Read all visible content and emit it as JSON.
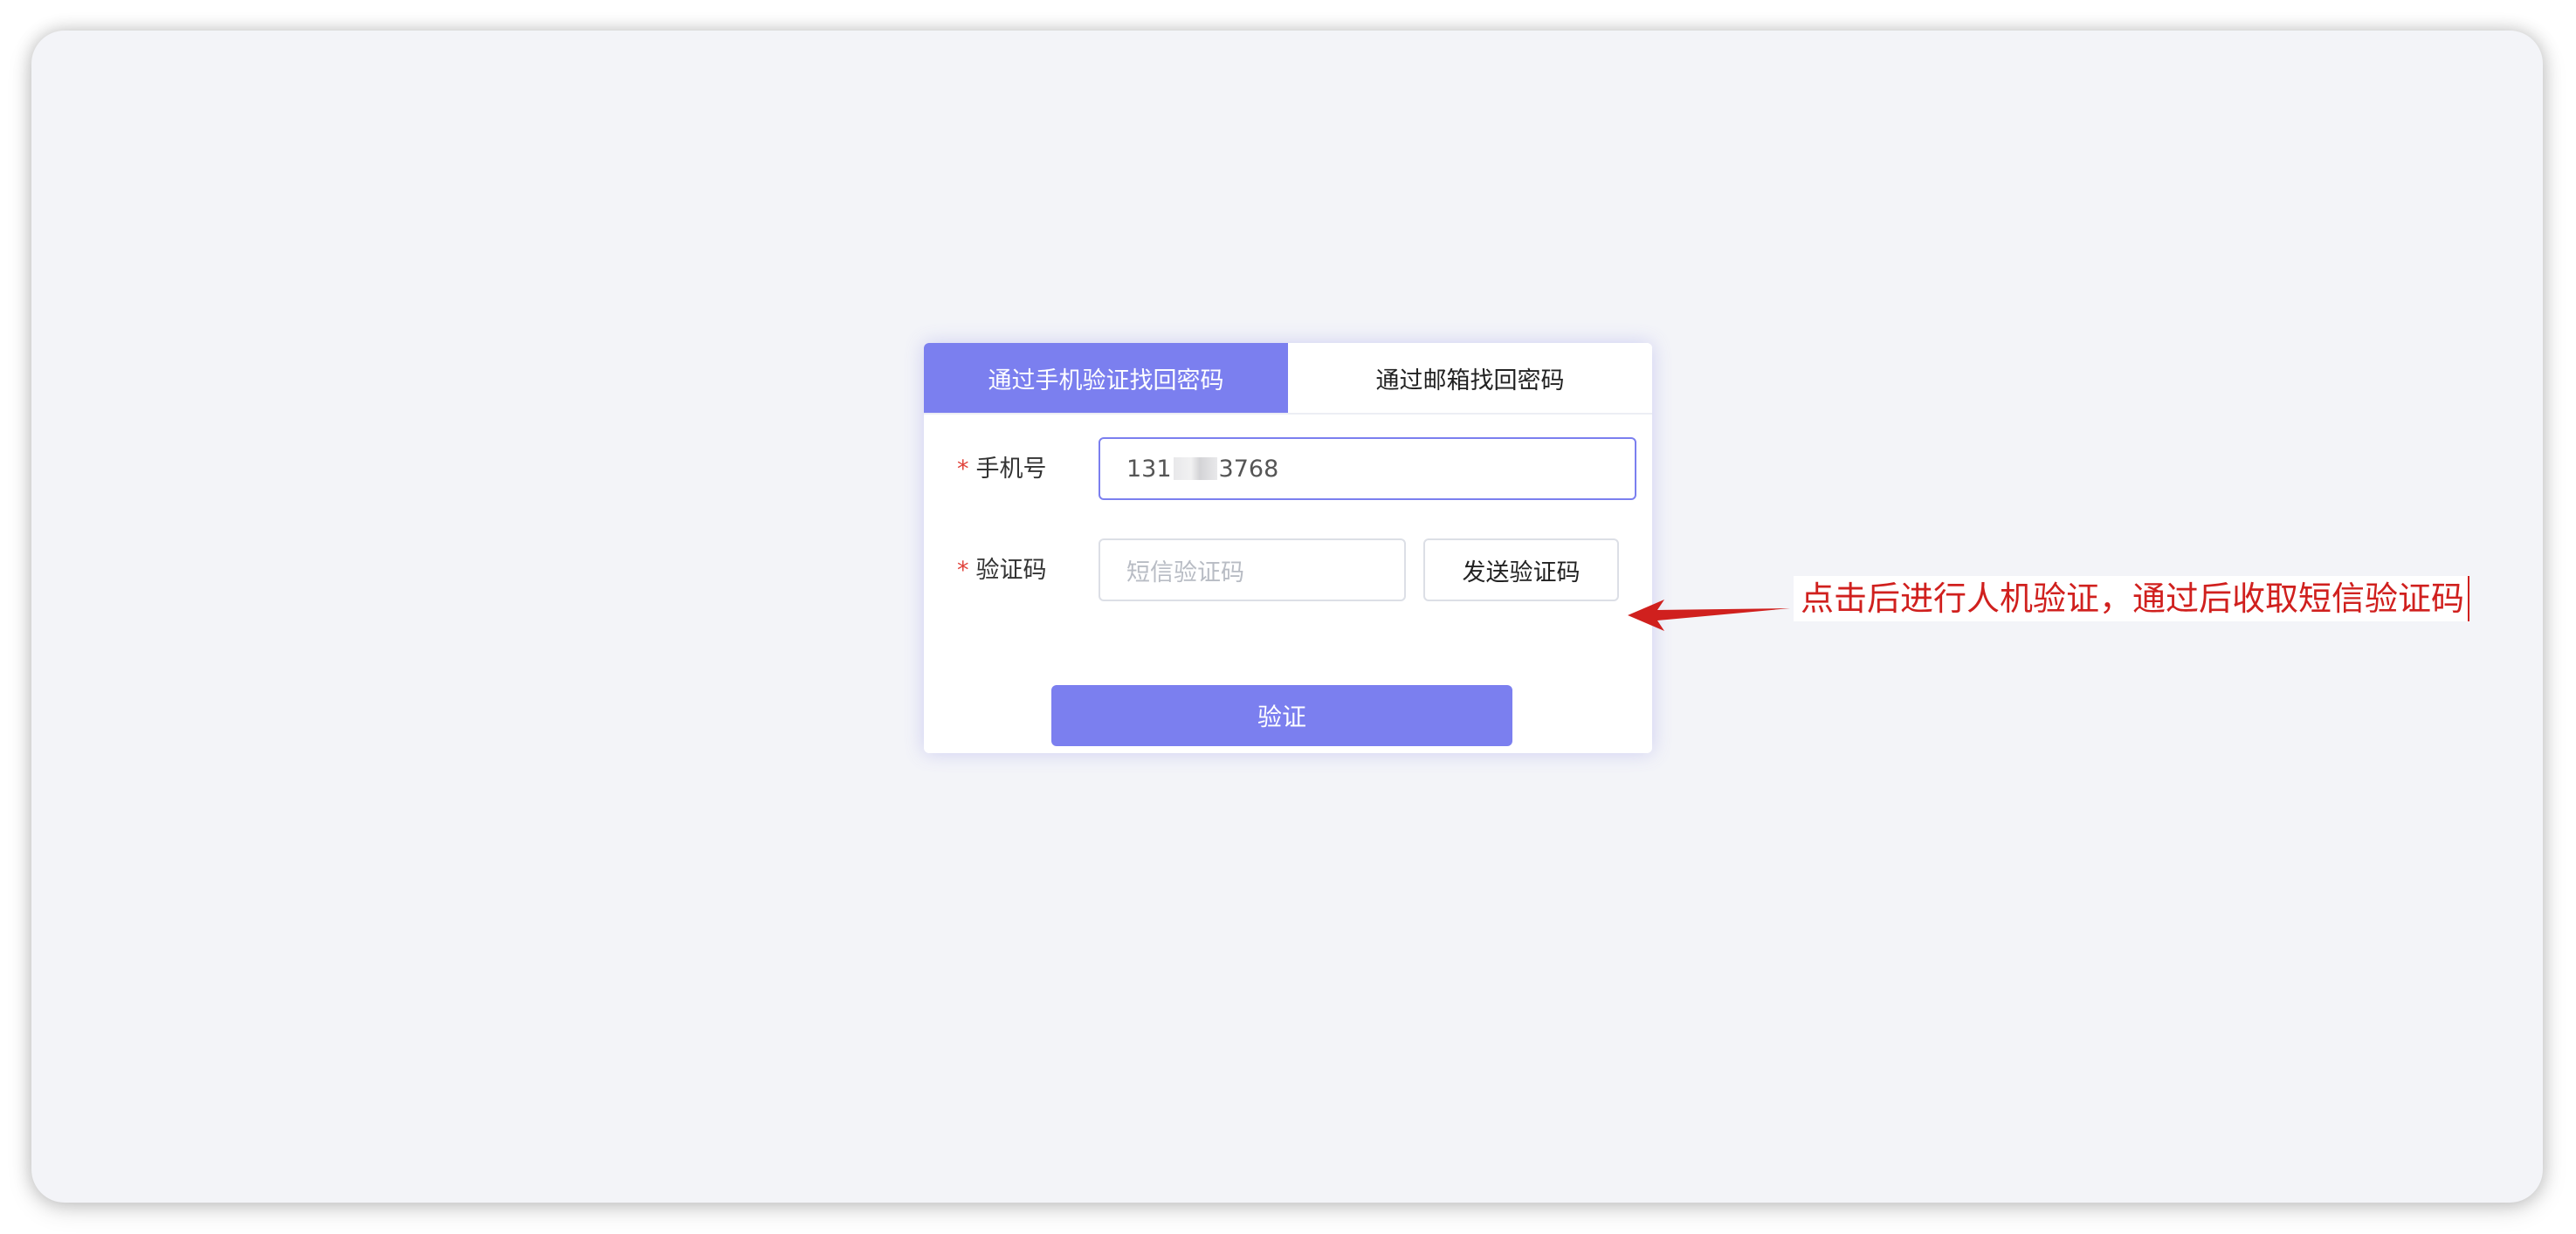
{
  "tabs": [
    {
      "label": "通过手机验证找回密码",
      "active": true
    },
    {
      "label": "通过邮箱找回密码",
      "active": false
    }
  ],
  "form": {
    "phone": {
      "required_mark": "*",
      "label": "手机号",
      "value_prefix": "131",
      "value_suffix": "3768"
    },
    "code": {
      "required_mark": "*",
      "label": "验证码",
      "placeholder": "短信验证码",
      "send_button": "发送验证码"
    },
    "submit_button": "验证"
  },
  "annotation": {
    "text": "点击后进行人机验证，通过后收取短信验证码"
  },
  "colors": {
    "accent": "#7b7fef",
    "background": "#f3f4f8",
    "annotation_red": "#d0201e",
    "required_red": "#e0433b"
  }
}
